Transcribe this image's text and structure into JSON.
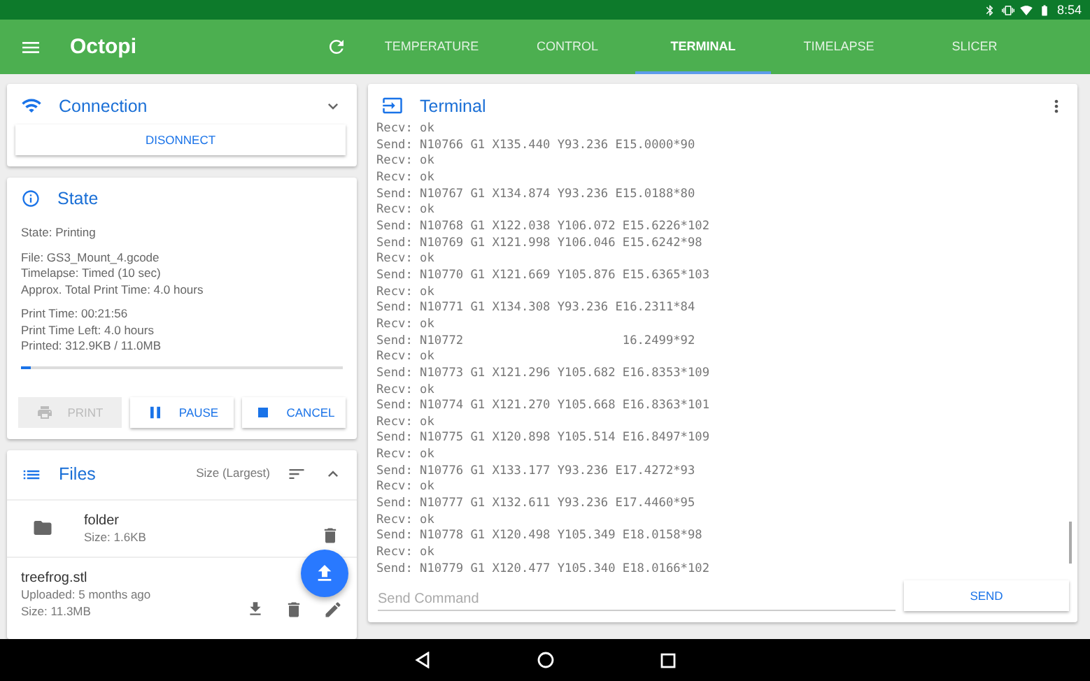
{
  "status_bar": {
    "time": "8:54"
  },
  "app_bar": {
    "title": "Octopi"
  },
  "tabs": [
    {
      "label": "TEMPERATURE",
      "selected": false
    },
    {
      "label": "CONTROL",
      "selected": false
    },
    {
      "label": "TERMINAL",
      "selected": true
    },
    {
      "label": "TIMELAPSE",
      "selected": false
    },
    {
      "label": "SLICER",
      "selected": false
    }
  ],
  "connection": {
    "title": "Connection",
    "button": "DISONNECT"
  },
  "state": {
    "title": "State",
    "groups": [
      [
        "State: Printing"
      ],
      [
        "File: GS3_Mount_4.gcode",
        "Timelapse: Timed (10 sec)",
        "Approx. Total Print Time: 4.0 hours"
      ],
      [
        "Print Time: 00:21:56",
        "Print Time Left: 4.0 hours",
        "Printed: 312.9KB / 11.0MB"
      ]
    ],
    "progress": {
      "level": 0.03
    },
    "buttons": [
      {
        "kind": "print",
        "label": "PRINT",
        "disabled": true
      },
      {
        "kind": "pause",
        "label": "PAUSE",
        "disabled": false
      },
      {
        "kind": "cancel",
        "label": "CANCEL",
        "disabled": false
      }
    ]
  },
  "files": {
    "title": "Files",
    "sort": "Size (Largest)",
    "items": [
      {
        "kind": "folder",
        "name": "folder",
        "details": [
          "Size: 1.6KB"
        ]
      },
      {
        "kind": "file",
        "name": "treefrog.stl",
        "details": [
          "Uploaded: 5 months ago",
          "Size: 11.3MB"
        ]
      }
    ]
  },
  "terminal": {
    "title": "Terminal",
    "lines": [
      {
        "text": "Recv: ok"
      },
      {
        "text": "Send: N10766 G1 X135.440 Y93.236 E15.0000*90"
      },
      {
        "text": "Recv: ok"
      },
      {
        "text": "Recv: ok"
      },
      {
        "text": "Send: N10767 G1 X134.874 Y93.236 E15.0188*80"
      },
      {
        "text": "Recv: ok"
      },
      {
        "text": "Send: N10768 G1 X122.038 Y106.072 E15.6226*102"
      },
      {
        "text": "Send: N10769 G1 X121.998 Y106.046 E15.6242*98"
      },
      {
        "text": "Recv: ok"
      },
      {
        "text": "Send: N10770 G1 X121.669 Y105.876 E15.6365*103"
      },
      {
        "text": "Recv: ok"
      },
      {
        "text": "Send: N10771 G1 X134.308 Y93.236 E16.2311*84"
      },
      {
        "text": "Recv: ok"
      },
      {
        "text": "Send: N10772",
        "tail": "16.2499*92"
      },
      {
        "text": "Recv: ok"
      },
      {
        "text": "Send: N10773 G1 X121.296 Y105.682 E16.8353*109"
      },
      {
        "text": "Recv: ok"
      },
      {
        "text": "Send: N10774 G1 X121.270 Y105.668 E16.8363*101"
      },
      {
        "text": "Recv: ok"
      },
      {
        "text": "Send: N10775 G1 X120.898 Y105.514 E16.8497*109"
      },
      {
        "text": "Recv: ok"
      },
      {
        "text": "Send: N10776 G1 X133.177 Y93.236 E17.4272*93"
      },
      {
        "text": "Recv: ok"
      },
      {
        "text": "Send: N10777 G1 X132.611 Y93.236 E17.4460*95"
      },
      {
        "text": "Recv: ok"
      },
      {
        "text": "Send: N10778 G1 X120.498 Y105.349 E18.0158*98"
      },
      {
        "text": "Recv: ok"
      },
      {
        "text": "Send: N10779 G1 X120.477 Y105.340 E18.0166*102"
      }
    ],
    "command": {
      "placeholder": "Send Command"
    },
    "send": "SEND"
  }
}
